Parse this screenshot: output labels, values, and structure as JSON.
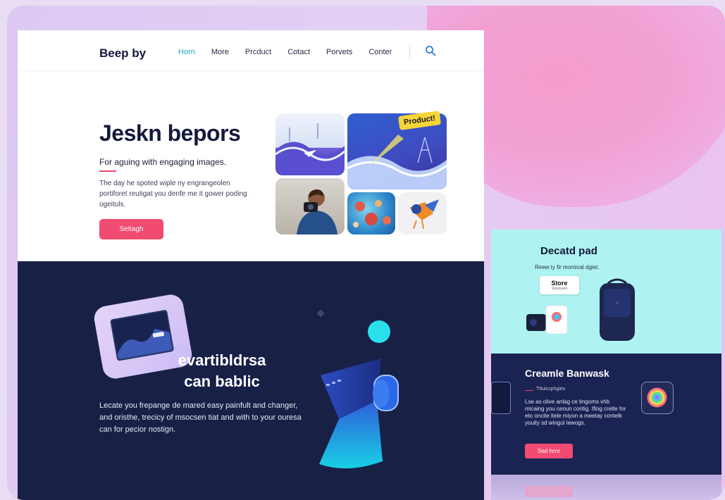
{
  "nav": {
    "brand": "Beep by",
    "links": [
      "Horn",
      "More",
      "Prcduct",
      "Cotact",
      "Porvets",
      "Conter"
    ]
  },
  "hero": {
    "title": "Jeskn bepors",
    "subtitle": "For aguing with engaging images.",
    "body": "The day he spoted wiple ny engrangeolen portiforet reutigat you denfe me it gower poding ogeituls.",
    "cta": "Setiagh",
    "product_tag": "Product!"
  },
  "dark_section": {
    "title_line1": "evartibldrsa",
    "title_line2": "can bablic",
    "body": "Lecate you frepange de mared easy painfult and changer, and oristhe, trecicy of msocsen tiat and with to your ouresa can for pecior nostign."
  },
  "right_panel": {
    "cyan_title": "Decatd pad",
    "cyan_sub": "Reew ty fir momical dgiet.",
    "store_label": "Store",
    "store_sub": "Sysrsyeet",
    "dark_title": "Creamle Banwask",
    "dark_tag": "Tttuiccphgies",
    "dark_body": "Lse as olive anlag ce tingoms vhb micaing you cenun coritig. Ifing crelte for eto oncite itele miyon a meetay contelk youity sd wingul lewogs.",
    "read_button": "Sed hcnr"
  },
  "colors": {
    "accent": "#f24b72",
    "navy": "#182046",
    "cyan": "#aef3f2",
    "teal": "#22a6c8",
    "yellow": "#f7d537"
  },
  "icons": {
    "search": "search-icon"
  }
}
